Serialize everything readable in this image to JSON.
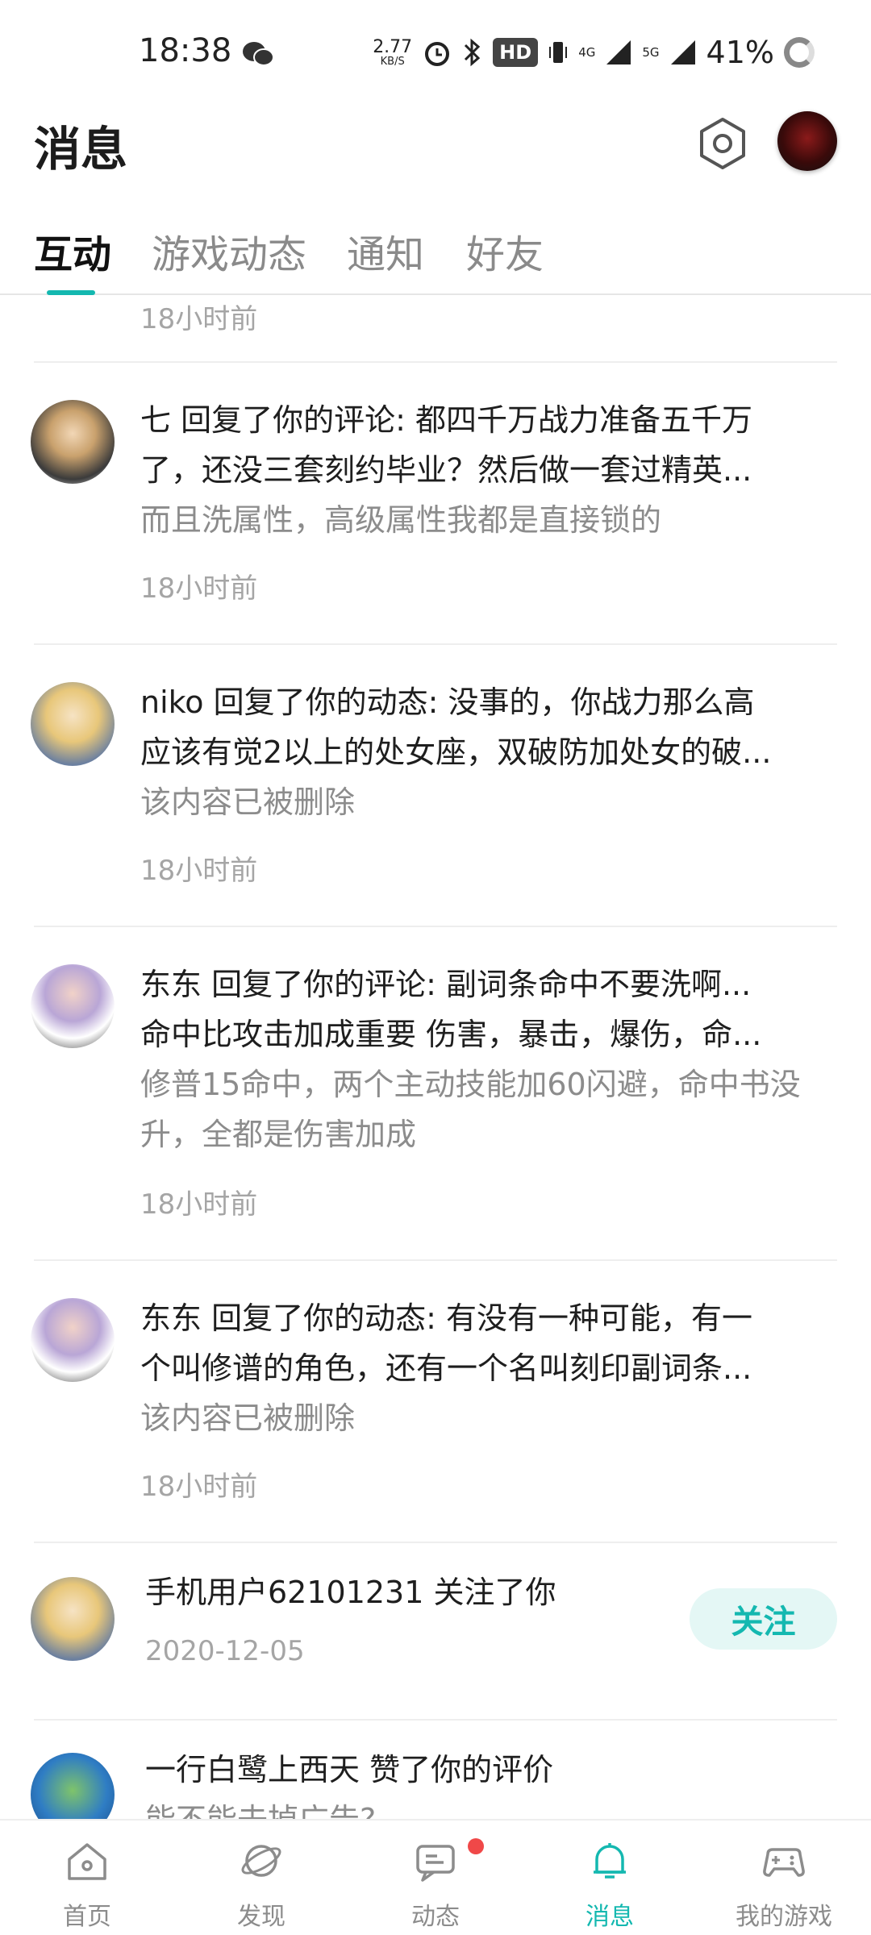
{
  "status_bar": {
    "time": "18:38",
    "net_speed": "2.77",
    "net_speed_unit": "KB/S",
    "hd_label": "HD",
    "net_4g": "4G",
    "net_5g": "5G",
    "battery": "41%"
  },
  "header": {
    "title": "消息"
  },
  "tabs": [
    "互动",
    "游戏动态",
    "通知",
    "好友"
  ],
  "list": {
    "prev_time": "18小时前",
    "messages": [
      {
        "line1": "七 回复了你的评论: 都四千万战力准备五千万",
        "line2": "了，还没三套刻约毕业？然后做一套过精英...",
        "quote": "而且洗属性，高级属性我都是直接锁的",
        "time": "18小时前"
      },
      {
        "line1": "niko 回复了你的动态: 没事的，你战力那么高",
        "line2": "应该有觉2以上的处女座，双破防加处女的破...",
        "quote": "该内容已被删除",
        "time": "18小时前"
      },
      {
        "line1": "东东 回复了你的评论: 副词条命中不要洗啊...",
        "line2": "命中比攻击加成重要  伤害，暴击，爆伤，命...",
        "quote": "修普15命中，两个主动技能加60闪避，命中书没升，全都是伤害加成",
        "time": "18小时前"
      },
      {
        "line1": "东东 回复了你的动态: 有没有一种可能，有一",
        "line2": "个叫修谱的角色，还有一个名叫刻印副词条...",
        "quote": "该内容已被删除",
        "time": "18小时前"
      }
    ],
    "follow": {
      "text": "手机用户62101231 关注了你",
      "date": "2020-12-05",
      "button": "关注"
    },
    "like": {
      "text": "一行白鹭上西天 赞了你的评价",
      "sub": "能不能去掉广告?"
    }
  },
  "bottom_nav": [
    {
      "label": "首页",
      "icon": "home-icon"
    },
    {
      "label": "发现",
      "icon": "discover-icon"
    },
    {
      "label": "动态",
      "icon": "feed-icon"
    },
    {
      "label": "消息",
      "icon": "bell-icon"
    },
    {
      "label": "我的游戏",
      "icon": "gamepad-icon"
    }
  ],
  "colors": {
    "accent": "#14b8b0",
    "badge": "#f04848"
  }
}
